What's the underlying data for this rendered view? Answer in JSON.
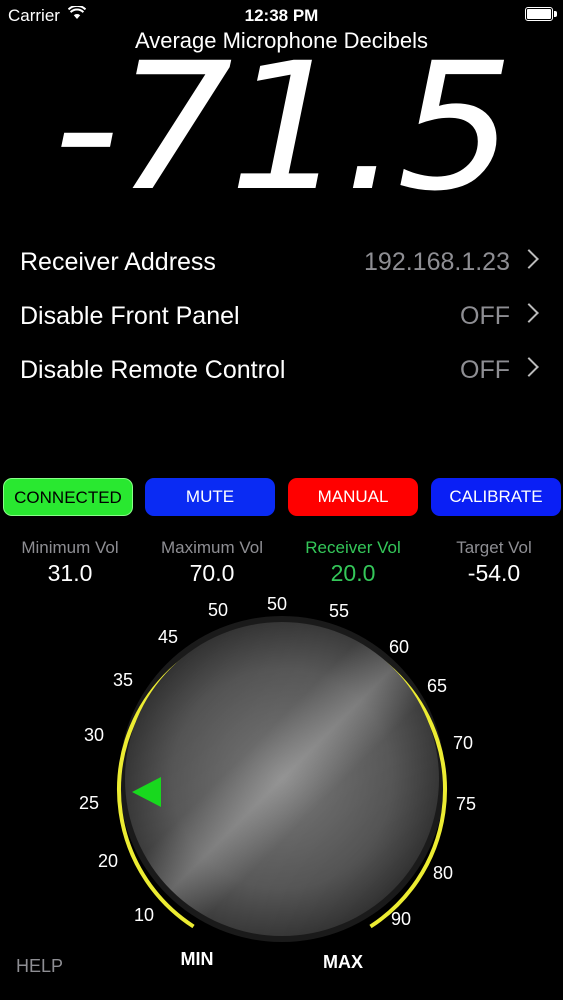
{
  "status": {
    "carrier": "Carrier",
    "time": "12:38 PM"
  },
  "meter": {
    "title": "Average Microphone Decibels",
    "value": "-71.5"
  },
  "settings": [
    {
      "label": "Receiver Address",
      "value": "192.168.1.23"
    },
    {
      "label": "Disable Front Panel",
      "value": "OFF"
    },
    {
      "label": "Disable Remote Control",
      "value": "OFF"
    }
  ],
  "buttons": {
    "connected": "CONNECTED",
    "mute": "MUTE",
    "manual": "MANUAL",
    "calibrate": "CALIBRATE"
  },
  "stats": [
    {
      "label": "Minimum Vol",
      "value": "31.0"
    },
    {
      "label": "Maximum Vol",
      "value": "70.0"
    },
    {
      "label": "Receiver Vol",
      "value": "20.0"
    },
    {
      "label": "Target Vol",
      "value": "-54.0"
    }
  ],
  "dial": {
    "ticks": [
      "10",
      "20",
      "25",
      "30",
      "35",
      "45",
      "50",
      "50",
      "55",
      "60",
      "65",
      "70",
      "75",
      "80",
      "90"
    ],
    "min_label": "MIN",
    "max_label": "MAX",
    "ring_color": "#ecec32",
    "pointer_color": "#18d81e",
    "pointer_level": 20.0
  },
  "help": "HELP"
}
